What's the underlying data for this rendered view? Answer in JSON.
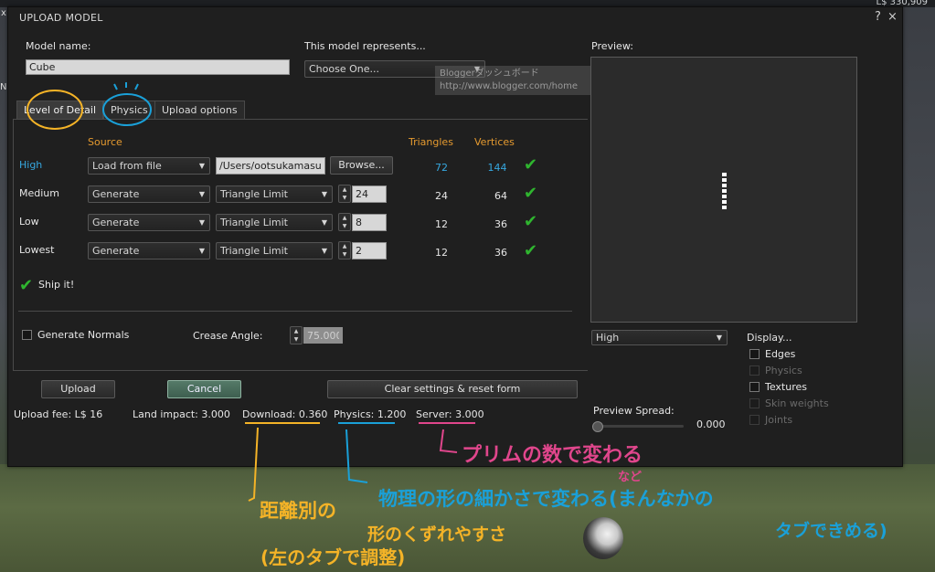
{
  "hud": {
    "price": "L$ 330,909",
    "left_fragment_1": "x",
    "left_fragment_2": "NI"
  },
  "window": {
    "title": "UPLOAD MODEL",
    "help_label": "?",
    "close_label": "×"
  },
  "model_name": {
    "label": "Model name:",
    "value": "Cube"
  },
  "represents": {
    "label": "This model represents...",
    "value": "Choose One..."
  },
  "tooltip": {
    "line1": "Bloggerダッシュボード",
    "line2": "http://www.blogger.com/home"
  },
  "tabs": [
    {
      "label": "Level of Detail"
    },
    {
      "label": "Physics"
    },
    {
      "label": "Upload options"
    }
  ],
  "lod": {
    "headers": {
      "source": "Source",
      "triangles": "Triangles",
      "vertices": "Vertices"
    },
    "rows": [
      {
        "level": "High",
        "source": "Load from file",
        "file": "/Users/ootsukamasum",
        "browse": "Browse...",
        "triangles": "72",
        "vertices": "144"
      },
      {
        "level": "Medium",
        "source": "Generate",
        "mode": "Triangle Limit",
        "limit": "24",
        "triangles": "24",
        "vertices": "64"
      },
      {
        "level": "Low",
        "source": "Generate",
        "mode": "Triangle Limit",
        "limit": "8",
        "triangles": "12",
        "vertices": "36"
      },
      {
        "level": "Lowest",
        "source": "Generate",
        "mode": "Triangle Limit",
        "limit": "2",
        "triangles": "12",
        "vertices": "36"
      }
    ],
    "ship_it": "Ship it!",
    "generate_normals": "Generate Normals",
    "crease_angle_label": "Crease Angle:",
    "crease_angle_value": "75.000"
  },
  "buttons": {
    "upload": "Upload",
    "cancel": "Cancel",
    "clear": "Clear settings & reset form"
  },
  "stats": {
    "upload_fee": "Upload fee: L$ 16",
    "land_impact": "Land impact: 3.000",
    "download": "Download: 0.360",
    "physics": "Physics: 1.200",
    "server": "Server: 3.000"
  },
  "preview": {
    "label": "Preview:",
    "lod_value": "High",
    "display_label": "Display...",
    "options": [
      {
        "label": "Edges",
        "enabled": true
      },
      {
        "label": "Physics",
        "enabled": false
      },
      {
        "label": "Textures",
        "enabled": true
      },
      {
        "label": "Skin weights",
        "enabled": false
      },
      {
        "label": "Joints",
        "enabled": false
      }
    ],
    "spread_label": "Preview Spread:",
    "spread_value": "0.000"
  },
  "notes": {
    "server_note": "プリムの数で変わる",
    "server_note_small": "など",
    "physics_note_1": "物理の形の細かさで変わる(まんなかの",
    "physics_note_2": "タブできめる)",
    "download_note_1": "距離別の",
    "download_note_2": "形のくずれやすさ",
    "download_note_3": "(左のタブで調整)"
  },
  "colors": {
    "accent_orange": "#e59a2f",
    "high_blue": "#36a8e0",
    "check_green": "#2fb52f",
    "note_pink": "#e0468c",
    "note_blue": "#1aa0d8",
    "note_orange": "#f4b327"
  }
}
